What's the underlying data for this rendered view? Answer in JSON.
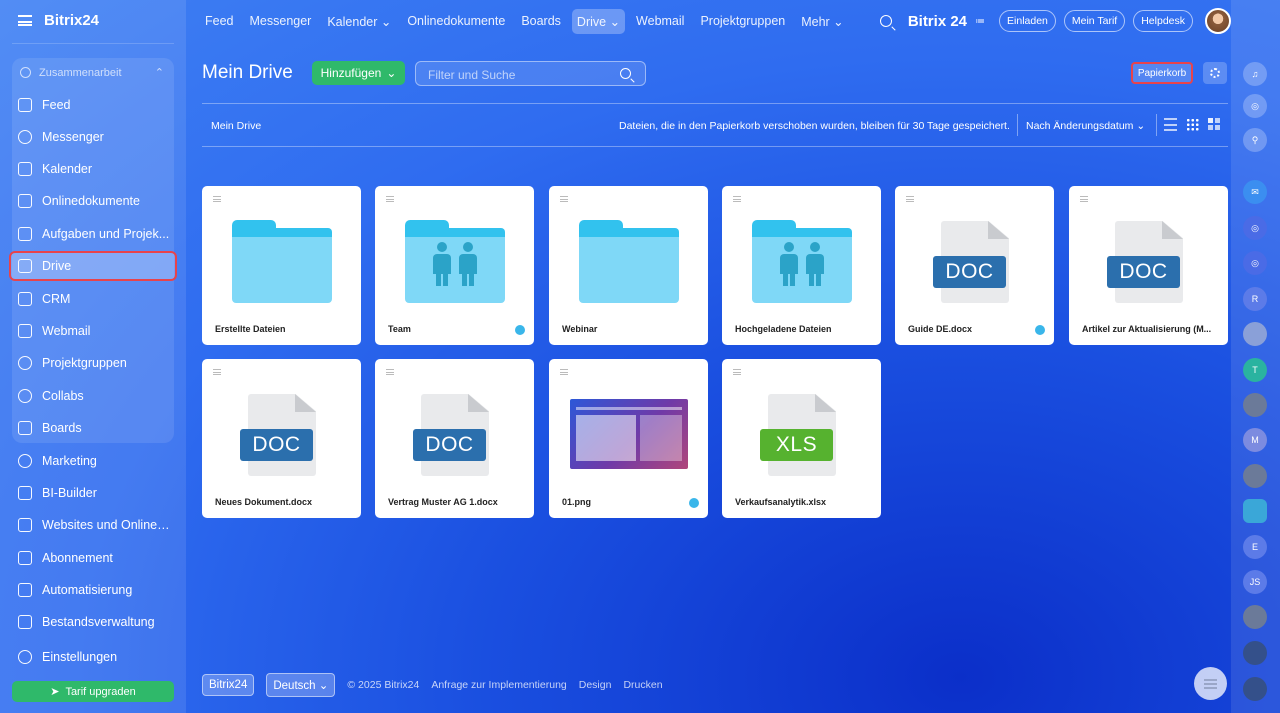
{
  "brand": {
    "name": "Bitrix24",
    "mark": "Ⓞ"
  },
  "sidebar": {
    "group_title": "Zusammenarbeit",
    "items": [
      {
        "label": "Feed",
        "icon": "feed-icon"
      },
      {
        "label": "Messenger",
        "icon": "chat-icon"
      },
      {
        "label": "Kalender",
        "icon": "calendar-icon"
      },
      {
        "label": "Onlinedokumente",
        "icon": "document-icon"
      },
      {
        "label": "Aufgaben und Projek...",
        "icon": "tasks-icon"
      },
      {
        "label": "Drive",
        "icon": "drive-icon"
      },
      {
        "label": "CRM",
        "icon": "crm-icon"
      },
      {
        "label": "Webmail",
        "icon": "mail-icon"
      },
      {
        "label": "Projektgruppen",
        "icon": "groups-icon"
      },
      {
        "label": "Collabs",
        "icon": "collabs-icon"
      },
      {
        "label": "Boards",
        "icon": "boards-icon"
      },
      {
        "label": "Marketing",
        "icon": "marketing-icon"
      },
      {
        "label": "BI-Builder",
        "icon": "chart-icon"
      },
      {
        "label": "Websites und Onlines...",
        "icon": "cart-icon"
      },
      {
        "label": "Abonnement",
        "icon": "subscription-icon"
      },
      {
        "label": "Automatisierung",
        "icon": "robot-icon"
      },
      {
        "label": "Bestandsverwaltung",
        "icon": "inventory-icon"
      },
      {
        "label": "Einstellungen",
        "icon": "settings-icon"
      }
    ],
    "upgrade_label": "Tarif upgraden"
  },
  "topnav": {
    "items": [
      "Feed",
      "Messenger",
      "Kalender ⌄",
      "Onlinedokumente",
      "Boards",
      "Drive ⌄",
      "Webmail",
      "Projektgruppen",
      "Mehr ⌄"
    ],
    "active": "Drive",
    "logo": "Bitrix 24",
    "invite": "Einladen",
    "plan": "Mein Tarif",
    "help": "Helpdesk"
  },
  "page": {
    "title": "Mein Drive",
    "add_label": "Hinzufügen",
    "filter_placeholder": "Filter und Suche",
    "trash_label": "Papierkorb",
    "breadcrumb": "Mein Drive",
    "notice": "Dateien, die in den Papierkorb verschoben wurden, bleiben für 30 Tage gespeichert.",
    "sort": "Nach Änderungsdatum"
  },
  "files": [
    {
      "name": "Erstellte Dateien",
      "kind": "folder",
      "shared": false
    },
    {
      "name": "Team",
      "kind": "folder-shared",
      "shared": true
    },
    {
      "name": "Webinar",
      "kind": "folder",
      "shared": false
    },
    {
      "name": "Hochgeladene Dateien",
      "kind": "folder-shared",
      "shared": false
    },
    {
      "name": "Guide DE.docx",
      "kind": "DOC",
      "shared": true
    },
    {
      "name": "Artikel zur Aktualisierung (M...",
      "kind": "DOC",
      "shared": false
    },
    {
      "name": "Neues Dokument.docx",
      "kind": "DOC",
      "shared": false
    },
    {
      "name": "Vertrag Muster AG 1.docx",
      "kind": "DOC",
      "shared": false
    },
    {
      "name": "01.png",
      "kind": "image",
      "shared": true
    },
    {
      "name": "Verkaufsanalytik.xlsx",
      "kind": "XLS",
      "shared": false
    }
  ],
  "footer": {
    "brand": "Bitrix24",
    "language": "Deutsch",
    "copyright": "© 2025 Bitrix24",
    "links": [
      "Anfrage zur Implementierung",
      "Design",
      "Drucken"
    ]
  },
  "rail": {
    "letters": [
      "R",
      "T",
      "M",
      "E",
      "JS"
    ]
  },
  "colors": {
    "accent_green": "#2fb96a",
    "highlight_red": "#e8434b",
    "folder": "#7fd8f7"
  }
}
